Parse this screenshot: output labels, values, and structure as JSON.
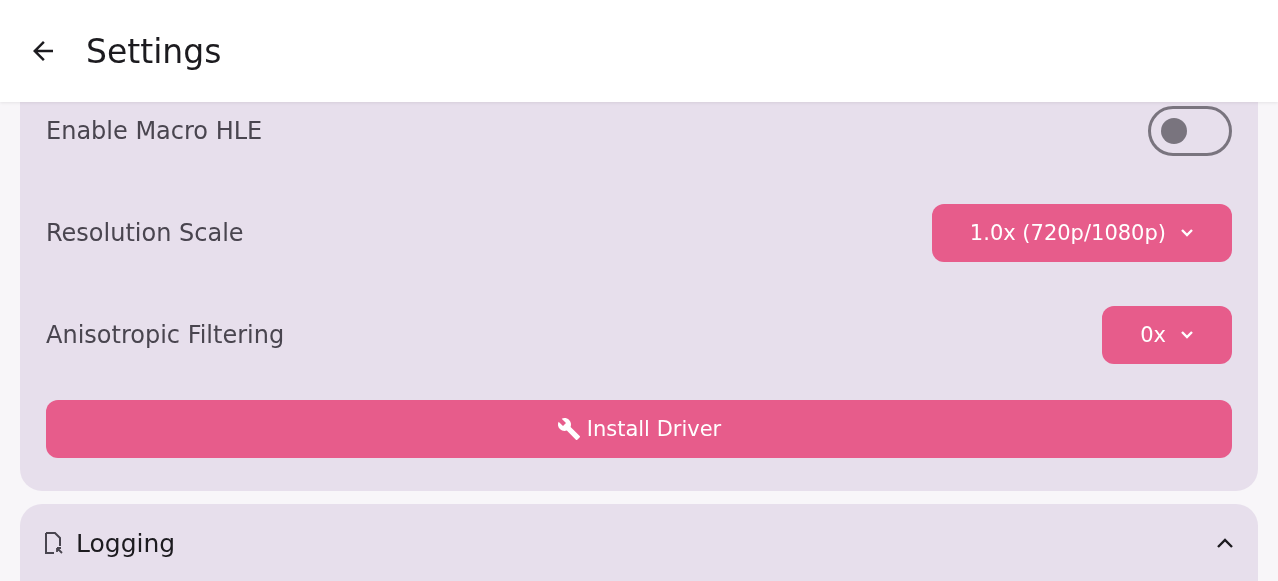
{
  "app_bar": {
    "title": "Settings"
  },
  "settings": [
    {
      "kind": "toggle",
      "label": "Enable Macro HLE",
      "on": false
    },
    {
      "kind": "dropdown",
      "label": "Resolution Scale",
      "value": "1.0x (720p/1080p)"
    },
    {
      "kind": "dropdown",
      "label": "Anisotropic Filtering",
      "value": "0x"
    },
    {
      "kind": "button",
      "label": "Install Driver"
    }
  ],
  "section": {
    "title": "Logging",
    "expanded": true
  }
}
